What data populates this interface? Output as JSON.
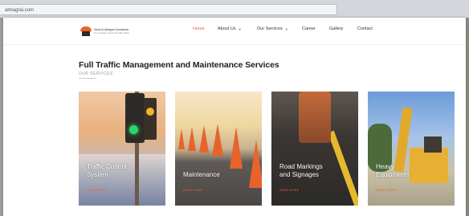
{
  "browser": {
    "url": "almagrai.com"
  },
  "brand": {
    "name": "Saudi Al-Almagrai Consultants",
    "tagline": "The complete solution for traffic safety"
  },
  "nav": {
    "items": [
      {
        "label": "Home",
        "active": true,
        "dropdown": false
      },
      {
        "label": "About Us",
        "active": false,
        "dropdown": true
      },
      {
        "label": "Our Services",
        "active": false,
        "dropdown": true
      },
      {
        "label": "Career",
        "active": false,
        "dropdown": false
      },
      {
        "label": "Gallery",
        "active": false,
        "dropdown": false
      },
      {
        "label": "Contact",
        "active": false,
        "dropdown": false
      }
    ]
  },
  "services": {
    "title": "Full Traffic Management and Maintenance Services",
    "subtitle": "OUR SERVICES",
    "cards": [
      {
        "title_line1": "Traffic Control",
        "title_line2": "System",
        "link": "READ MORE"
      },
      {
        "title_line1": "Maintenance",
        "title_line2": "",
        "link": "READ MORE"
      },
      {
        "title_line1": "Road Markings",
        "title_line2": "and Signages",
        "link": "READ MORE"
      },
      {
        "title_line1": "Heavy",
        "title_line2": "Equipments",
        "link": "READ MORE"
      }
    ]
  },
  "colors": {
    "accent": "#e8632b"
  }
}
